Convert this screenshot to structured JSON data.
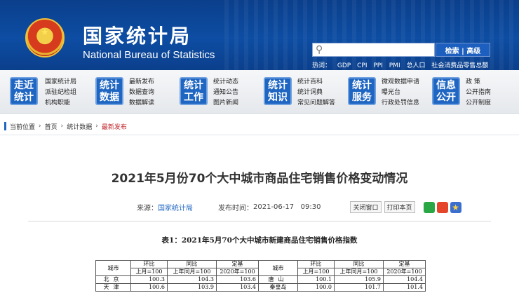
{
  "header": {
    "title_cn": "国家统计局",
    "title_en": "National Bureau of Statistics",
    "search_button": "检索 | 高级",
    "search_placeholder": "",
    "hot_label": "热词：",
    "hot_words": [
      "GDP",
      "CPI",
      "PPI",
      "PMI",
      "总人口",
      "社会消费品零售总额"
    ]
  },
  "nav": {
    "groups": [
      {
        "badge": "走近\n统计",
        "links": [
          [
            "国家统计局",
            "派驻纪检组",
            "机构职能"
          ]
        ]
      },
      {
        "badge": "统计\n数据",
        "links": [
          [
            "最新发布",
            "数据查询",
            "数据解读"
          ]
        ]
      },
      {
        "badge": "统计\n工作",
        "links": [
          [
            "统计动态",
            "通知公告",
            "图片新闻"
          ]
        ]
      },
      {
        "badge": "统计\n知识",
        "links": [
          [
            "统计百科",
            "统计词典",
            "常见问题解答"
          ]
        ]
      },
      {
        "badge": "统计\n服务",
        "links": [
          [
            "微观数据申请",
            "曝光台",
            "行政处罚信息"
          ]
        ]
      },
      {
        "badge": "信息\n公开",
        "links": [
          [
            "政  策",
            "公开指南",
            "公开制度"
          ]
        ]
      }
    ]
  },
  "breadcrumb": {
    "label": "当前位置",
    "items": [
      "首页",
      "统计数据",
      "最新发布"
    ]
  },
  "article": {
    "title": "2021年5月份70个大中城市商品住宅销售价格变动情况",
    "source_label": "来源：",
    "source": "国家统计局",
    "date_label": "发布时间：",
    "date": "2021-06-17   09:30",
    "close_window": "关闭窗口",
    "print_page": "打印本页"
  },
  "table": {
    "caption": "表1：2021年5月70个大中城市新建商品住宅销售价格指数",
    "col_city": "城市",
    "h_mom": "环比",
    "h_yoy": "同比",
    "h_base": "定基",
    "s_mom": "上月=100",
    "s_yoy": "上年同月=100",
    "s_base": "2020年=100",
    "rows": [
      {
        "c1": "北京",
        "v1": "100.3",
        "v2": "104.3",
        "v3": "103.6",
        "c2": "唐山",
        "v4": "100.1",
        "v5": "105.9",
        "v6": "104.4"
      },
      {
        "c1": "天津",
        "v1": "100.6",
        "v2": "103.9",
        "v3": "103.4",
        "c2": "秦皇岛",
        "v4": "100.0",
        "v5": "101.7",
        "v6": "101.4"
      }
    ]
  },
  "colors": {
    "header_blue": "#0d4da3",
    "nav_badge": "#1f66c2",
    "current_crumb": "#c1272d",
    "source_link": "#1f66c2"
  }
}
